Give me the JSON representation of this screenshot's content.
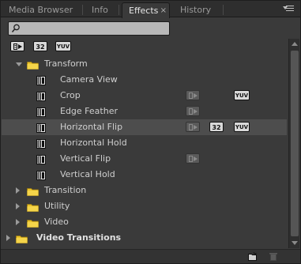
{
  "tabs": [
    {
      "label": "Media Browser",
      "active": false
    },
    {
      "label": "Info",
      "active": false
    },
    {
      "label": "Effects",
      "active": true
    },
    {
      "label": "History",
      "active": false
    }
  ],
  "tab_close_glyph": "×",
  "search": {
    "value": "",
    "placeholder": ""
  },
  "filters": [
    {
      "name": "accelerated-effects",
      "label": "",
      "icon": "accelerated-icon"
    },
    {
      "name": "32-bit-color",
      "label": "32"
    },
    {
      "name": "yuv",
      "label": "YUV"
    }
  ],
  "tree": [
    {
      "label": "Transform",
      "kind": "folder",
      "depth": 1,
      "expanded": true
    },
    {
      "label": "Camera View",
      "kind": "effect",
      "depth": 2,
      "accel": false,
      "b32": false,
      "yuv": false
    },
    {
      "label": "Crop",
      "kind": "effect",
      "depth": 2,
      "accel": true,
      "accel_dim": true,
      "b32": false,
      "yuv": true
    },
    {
      "label": "Edge Feather",
      "kind": "effect",
      "depth": 2,
      "accel": true,
      "accel_dim": true,
      "b32": false,
      "yuv": false
    },
    {
      "label": "Horizontal Flip",
      "kind": "effect",
      "depth": 2,
      "selected": true,
      "accel": true,
      "accel_dim": true,
      "b32": true,
      "yuv": true
    },
    {
      "label": "Horizontal Hold",
      "kind": "effect",
      "depth": 2,
      "accel": false,
      "b32": false,
      "yuv": false
    },
    {
      "label": "Vertical Flip",
      "kind": "effect",
      "depth": 2,
      "accel": true,
      "accel_dim": true,
      "b32": false,
      "yuv": false
    },
    {
      "label": "Vertical Hold",
      "kind": "effect",
      "depth": 2,
      "accel": false,
      "b32": false,
      "yuv": false
    },
    {
      "label": "Transition",
      "kind": "folder",
      "depth": 1,
      "expanded": false
    },
    {
      "label": "Utility",
      "kind": "folder",
      "depth": 1,
      "expanded": false
    },
    {
      "label": "Video",
      "kind": "folder",
      "depth": 1,
      "expanded": false
    },
    {
      "label": "Video Transitions",
      "kind": "folder",
      "depth": 0,
      "expanded": false,
      "bold": true
    }
  ],
  "badge_labels": {
    "b32": "32",
    "yuv": "YUV"
  },
  "colors": {
    "folder": "#e8c12a",
    "panel": "#3a3a3a",
    "selection": "#4d4d4d",
    "badge": "#d8d8d8"
  },
  "bottom_icons": [
    "new-custom-bin-icon",
    "delete-icon"
  ]
}
